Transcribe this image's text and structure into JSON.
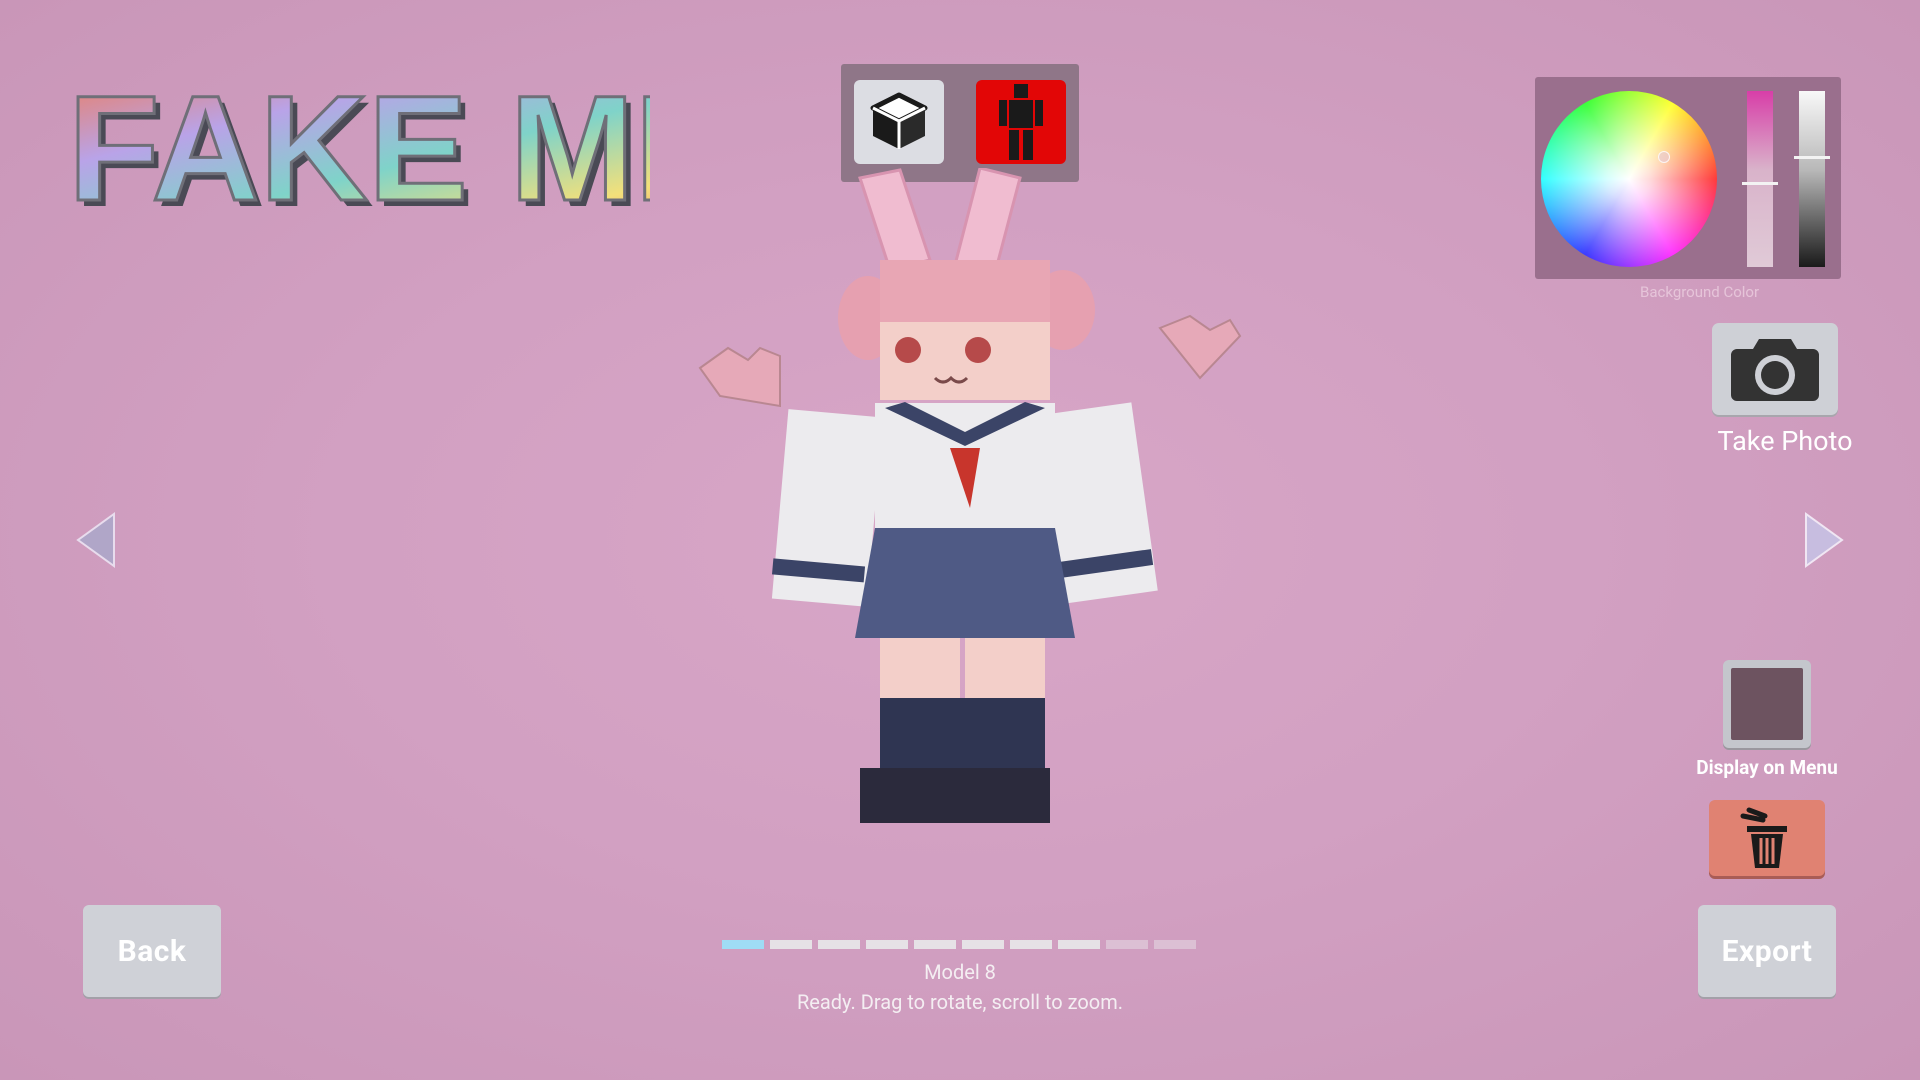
{
  "app": {
    "logo_text": "FAKE ME"
  },
  "mode_toggle": {
    "items": [
      {
        "icon": "cube-icon",
        "label": ""
      },
      {
        "icon": "body-icon",
        "label": ""
      }
    ],
    "selected": "body-icon"
  },
  "color_picker": {
    "label": "Background Color",
    "accent": "#d83ea8"
  },
  "actions": {
    "take_photo": "Take Photo",
    "display_on_menu": "Display on Menu",
    "back": "Back",
    "export": "Export"
  },
  "pager": {
    "total": 10,
    "active_index": 0,
    "dim_from": 8
  },
  "model": {
    "name": "Model 8",
    "status": "Ready. Drag to rotate, scroll to zoom."
  },
  "colors": {
    "background": "#d2a0c2",
    "active_dot": "#9fdcf5",
    "delete_button": "#e08272"
  }
}
